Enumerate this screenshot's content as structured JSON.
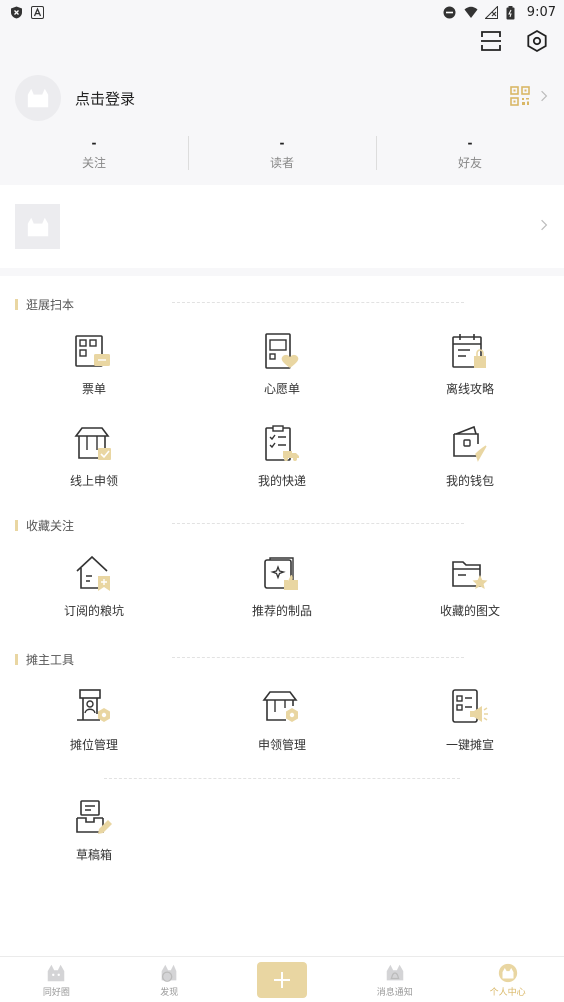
{
  "status_bar": {
    "time": "9:07",
    "left_icons": [
      "shield-x-icon",
      "notification-a-icon"
    ],
    "right_icons": [
      "dnd-icon",
      "wifi-icon",
      "no-signal-icon",
      "battery-icon"
    ]
  },
  "top_actions": {
    "scan_icon": "scan-icon",
    "settings_icon": "settings-icon"
  },
  "profile": {
    "login_text": "点击登录",
    "qr_icon": "qr-code-icon"
  },
  "stats": [
    {
      "value": "-",
      "label": "关注"
    },
    {
      "value": "-",
      "label": "读者"
    },
    {
      "value": "-",
      "label": "好友"
    }
  ],
  "sections": [
    {
      "title": "逛展扫本",
      "items": [
        {
          "label": "票单",
          "icon": "ticket-icon"
        },
        {
          "label": "心愿单",
          "icon": "wishlist-icon"
        },
        {
          "label": "离线攻略",
          "icon": "offline-guide-icon"
        },
        {
          "label": "线上申领",
          "icon": "online-claim-icon"
        },
        {
          "label": "我的快递",
          "icon": "delivery-icon"
        },
        {
          "label": "我的钱包",
          "icon": "wallet-icon"
        }
      ]
    },
    {
      "title": "收藏关注",
      "items": [
        {
          "label": "订阅的粮坑",
          "icon": "subscribed-icon"
        },
        {
          "label": "推荐的制品",
          "icon": "recommended-icon"
        },
        {
          "label": "收藏的图文",
          "icon": "favorites-folder-icon"
        }
      ]
    },
    {
      "title": "摊主工具",
      "items": [
        {
          "label": "摊位管理",
          "icon": "booth-manage-icon"
        },
        {
          "label": "申领管理",
          "icon": "claim-manage-icon"
        },
        {
          "label": "一键摊宣",
          "icon": "promo-icon"
        },
        {
          "label": "草稿箱",
          "icon": "drafts-icon"
        }
      ]
    }
  ],
  "tabbar": [
    {
      "label": "同好圈",
      "icon": "circle-tab-icon"
    },
    {
      "label": "发现",
      "icon": "discover-tab-icon"
    },
    {
      "label": "",
      "icon": "plus-icon"
    },
    {
      "label": "消息通知",
      "icon": "messages-tab-icon"
    },
    {
      "label": "个人中心",
      "icon": "profile-tab-icon",
      "active": true
    }
  ],
  "colors": {
    "accent": "#e9d6a2",
    "active_tab": "#d9b766",
    "icon_stroke": "#333333"
  }
}
